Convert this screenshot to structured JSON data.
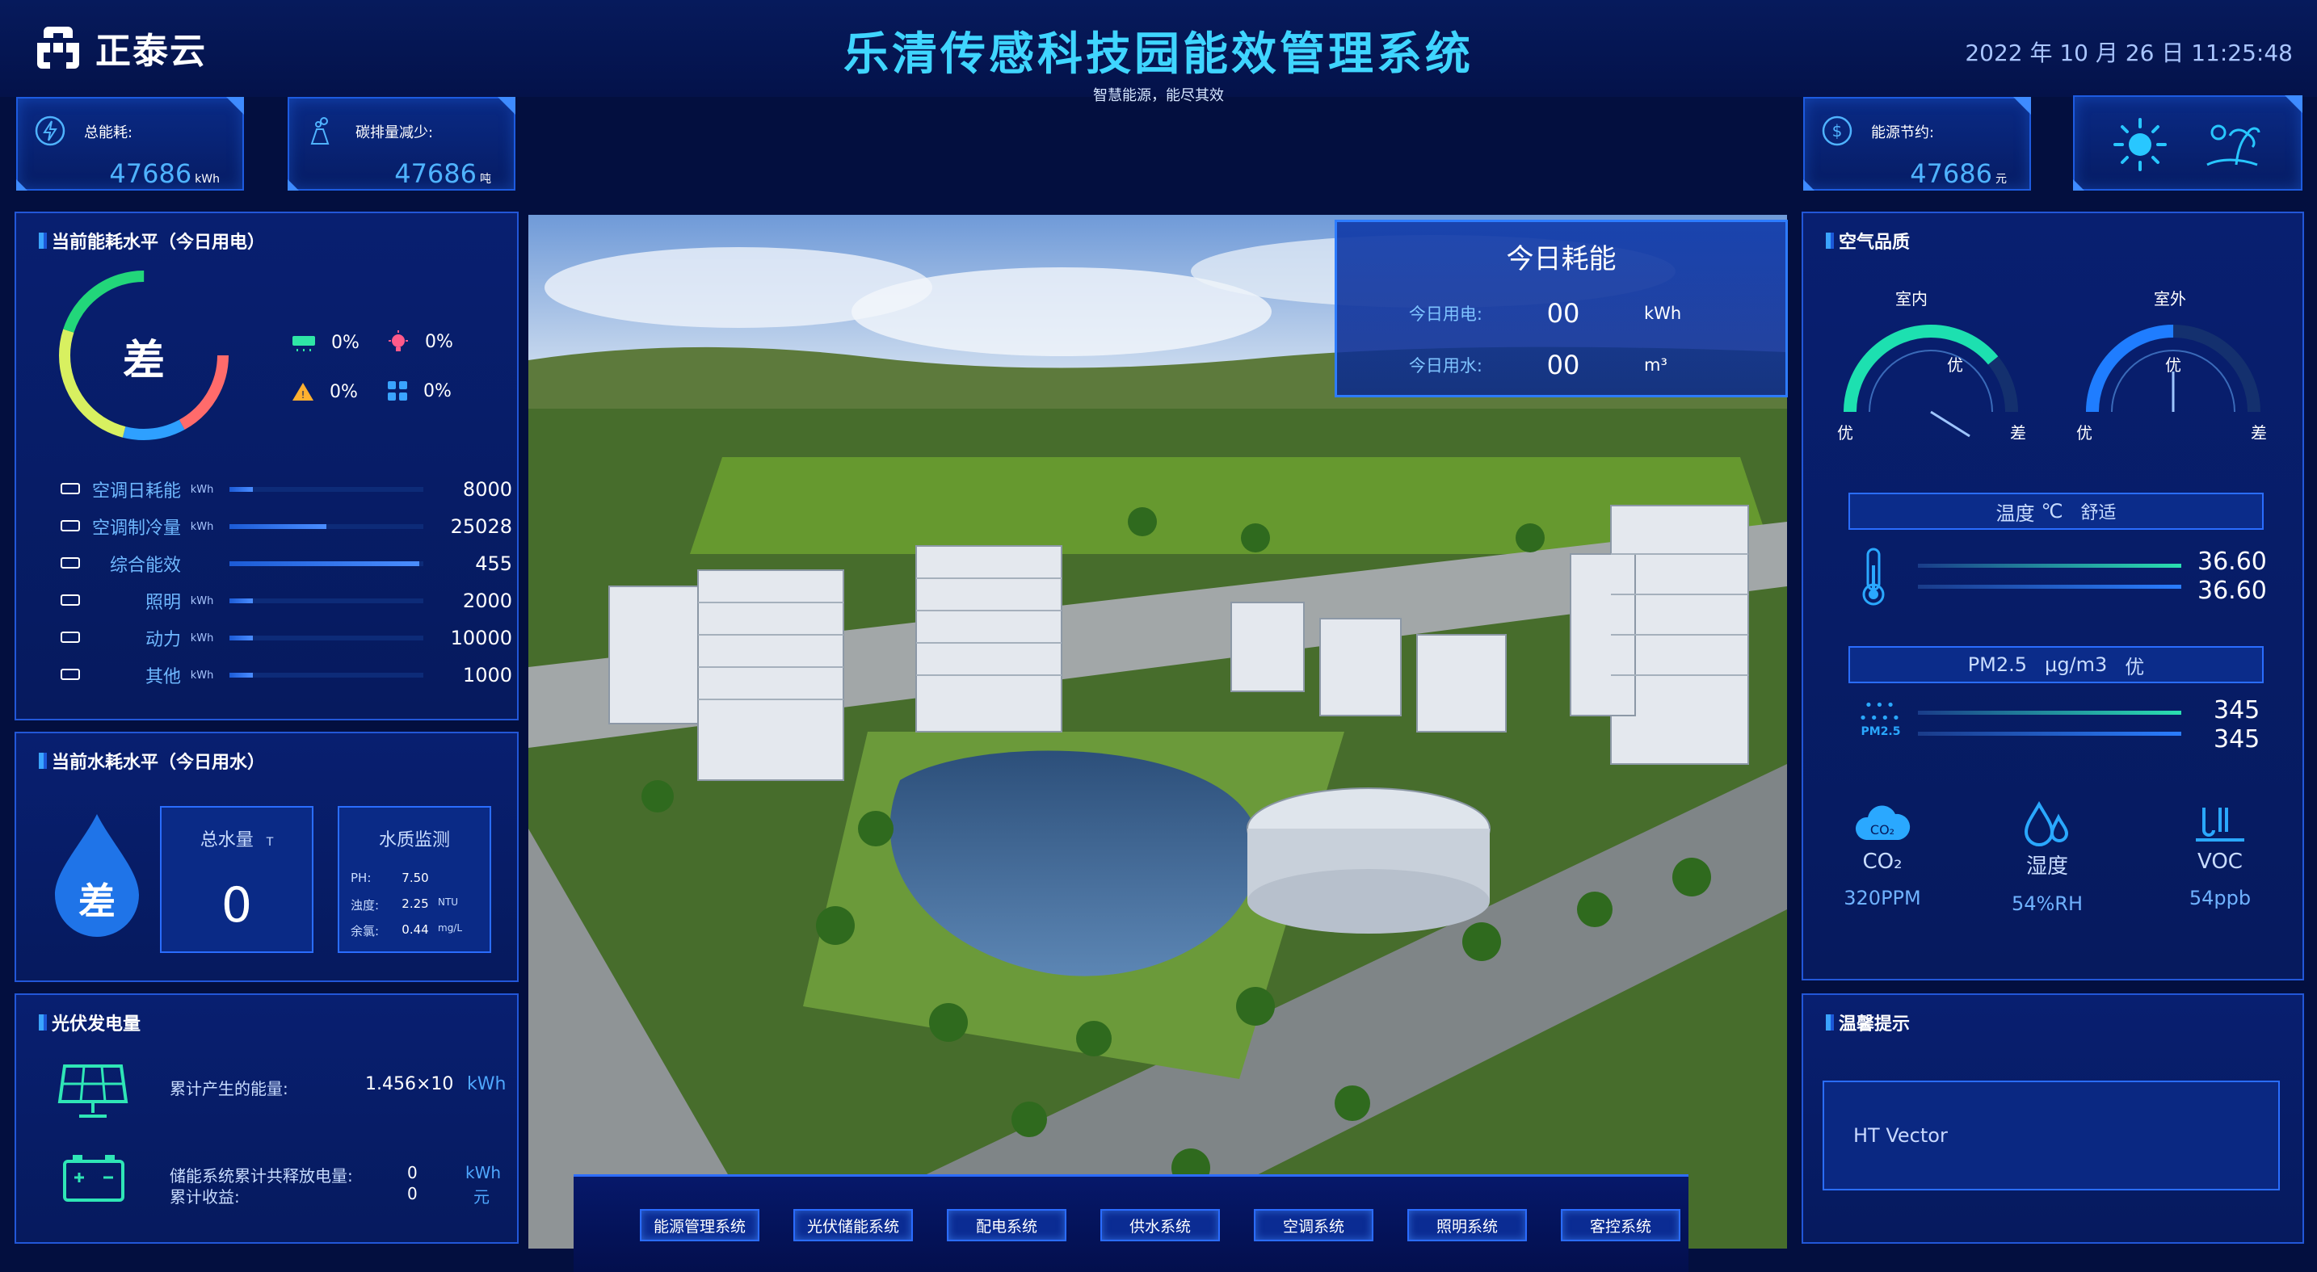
{
  "header": {
    "logo_text": "正泰云",
    "title": "乐清传感科技园能效管理系统",
    "subtitle": "智慧能源，能尽其效",
    "datetime": "2022 年 10 月 26 日 11:25:48"
  },
  "kpis": {
    "total_energy": {
      "label": "总能耗:",
      "value": "47686",
      "unit": "kWh"
    },
    "carbon": {
      "label": "碳排量减少:",
      "value": "47686",
      "unit": "吨"
    },
    "saving": {
      "label": "能源节约:",
      "value": "47686",
      "unit": "元"
    }
  },
  "weather": {
    "icons": [
      "sun-icon",
      "beach-icon"
    ]
  },
  "energy_panel": {
    "title": "当前能耗水平（今日用电）",
    "grade": "差",
    "legend": [
      {
        "icon": "ac-icon",
        "value": "0%",
        "color": "#2fe6a6"
      },
      {
        "icon": "light-icon",
        "value": "0%",
        "color": "#ff5a8a"
      },
      {
        "icon": "power-icon",
        "value": "0%",
        "color": "#ffb030"
      },
      {
        "icon": "other-icon",
        "value": "0%",
        "color": "#3aa4ff"
      }
    ],
    "ring_colors": [
      "#ff6b6b",
      "#2ea0ff",
      "#d8f060",
      "#22d67a"
    ],
    "rows": [
      {
        "name": "空调日耗能",
        "unit": "kWh",
        "value": "8000",
        "fill": 0.12
      },
      {
        "name": "空调制冷量",
        "unit": "kWh",
        "value": "25028",
        "fill": 0.5
      },
      {
        "name": "综合能效",
        "unit": "",
        "value": "455",
        "fill": 0.98
      },
      {
        "name": "照明",
        "unit": "kWh",
        "value": "2000",
        "fill": 0.12
      },
      {
        "name": "动力",
        "unit": "kWh",
        "value": "10000",
        "fill": 0.12
      },
      {
        "name": "其他",
        "unit": "kWh",
        "value": "1000",
        "fill": 0.12
      }
    ]
  },
  "water_panel": {
    "title": "当前水耗水平（今日用水）",
    "grade": "差",
    "total_label": "总水量",
    "total_unit": "T",
    "total_value": "0",
    "quality_title": "水质监测",
    "quality": [
      {
        "name": "PH:",
        "value": "7.50",
        "unit": ""
      },
      {
        "name": "浊度:",
        "value": "2.25",
        "unit": "NTU"
      },
      {
        "name": "余氯:",
        "value": "0.44",
        "unit": "mg/L"
      }
    ]
  },
  "pv_panel": {
    "title": "光伏发电量",
    "cumulative_label": "累计产生的能量:",
    "cumulative_value": "1.456×10",
    "cumulative_unit": "kWh",
    "storage_label": "储能系统累计共释放电量:",
    "storage_value": "0",
    "storage_unit": "kWh",
    "income_label": "累计收益:",
    "income_value": "0",
    "income_unit": "元"
  },
  "today_box": {
    "title": "今日耗能",
    "rows": [
      {
        "label": "今日用电:",
        "value": "00",
        "unit": "kWh"
      },
      {
        "label": "今日用水:",
        "value": "00",
        "unit": "m³"
      }
    ]
  },
  "nav": [
    "能源管理系统",
    "光伏储能系统",
    "配电系统",
    "供水系统",
    "空调系统",
    "照明系统",
    "客控系统"
  ],
  "air_panel": {
    "title": "空气品质",
    "indoor": {
      "label": "室内",
      "grade": "优",
      "left": "优",
      "right": "差",
      "level": 0.78
    },
    "outdoor": {
      "label": "室外",
      "grade": "优",
      "left": "优",
      "right": "差",
      "level": 0.5
    },
    "temperature": {
      "title": "温度",
      "unit": "℃",
      "status": "舒适",
      "v1": "36.60",
      "v2": "36.60"
    },
    "pm25": {
      "title": "PM2.5",
      "unit": "μg/m3",
      "status": "优",
      "v1": "345",
      "v2": "345",
      "icon_text": "PM2.5"
    },
    "items": [
      {
        "icon": "co2-icon",
        "name": "CO₂",
        "value": "320PPM",
        "icon_text": "CO₂"
      },
      {
        "icon": "humidity-icon",
        "name": "湿度",
        "value": "54%RH"
      },
      {
        "icon": "voc-icon",
        "name": "VOC",
        "value": "54ppb"
      }
    ]
  },
  "tip_panel": {
    "title": "温馨提示",
    "text": "HT Vector"
  }
}
